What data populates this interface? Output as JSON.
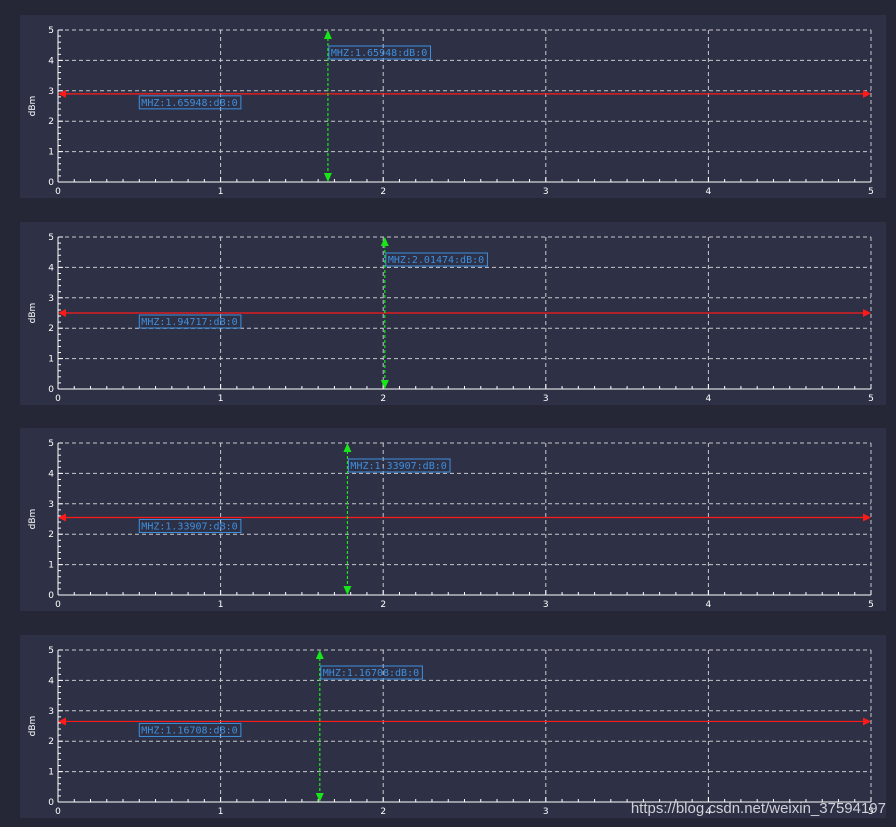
{
  "colors": {
    "page_bg": "#252737",
    "panel_bg": "#2e3145",
    "grid": "#c8c8cc",
    "axis": "#ffffff",
    "h_marker": "#ff1a1a",
    "v_marker": "#19e619",
    "label_text": "#3d8fe0",
    "label_border": "#3d8fe0"
  },
  "watermark": "https://blog.csdn.net/weixin_37594197",
  "chart_data": [
    {
      "type": "line",
      "ylabel": "dBm",
      "xlim": [
        0,
        5
      ],
      "ylim": [
        0,
        5
      ],
      "xticks": [
        "0",
        "1",
        "2",
        "3",
        "4",
        "5"
      ],
      "yticks": [
        "0",
        "1",
        "2",
        "3",
        "4",
        "5"
      ],
      "grid": true,
      "horizontal_marker": {
        "y": 2.9,
        "label": "MHZ:1.65948:dB:0",
        "label_x": 0.5
      },
      "vertical_marker": {
        "x": 1.66,
        "label": "MHZ:1.65948:dB:0"
      }
    },
    {
      "type": "line",
      "ylabel": "dBm",
      "xlim": [
        0,
        5
      ],
      "ylim": [
        0,
        5
      ],
      "xticks": [
        "0",
        "1",
        "2",
        "3",
        "4",
        "5"
      ],
      "yticks": [
        "0",
        "1",
        "2",
        "3",
        "4",
        "5"
      ],
      "grid": true,
      "horizontal_marker": {
        "y": 2.5,
        "label": "MHZ:1.94717:dB:0",
        "label_x": 0.5
      },
      "vertical_marker": {
        "x": 2.01,
        "label": "MHZ:2.01474:dB:0"
      }
    },
    {
      "type": "line",
      "ylabel": "dBm",
      "xlim": [
        0,
        5
      ],
      "ylim": [
        0,
        5
      ],
      "xticks": [
        "0",
        "1",
        "2",
        "3",
        "4",
        "5"
      ],
      "yticks": [
        "0",
        "1",
        "2",
        "3",
        "4",
        "5"
      ],
      "grid": true,
      "horizontal_marker": {
        "y": 2.55,
        "label": "MHZ:1.33907:dB:0",
        "label_x": 0.5
      },
      "vertical_marker": {
        "x": 1.78,
        "label": "MHZ:1.33907:dB:0"
      }
    },
    {
      "type": "line",
      "ylabel": "dBm",
      "xlim": [
        0,
        5
      ],
      "ylim": [
        0,
        5
      ],
      "xticks": [
        "0",
        "1",
        "2",
        "3",
        "4",
        "5"
      ],
      "yticks": [
        "0",
        "1",
        "2",
        "3",
        "4",
        "5"
      ],
      "grid": true,
      "horizontal_marker": {
        "y": 2.65,
        "label": "MHZ:1.16708:dB:0",
        "label_x": 0.5
      },
      "vertical_marker": {
        "x": 1.61,
        "label": "MHZ:1.16708:dB:0"
      }
    }
  ]
}
